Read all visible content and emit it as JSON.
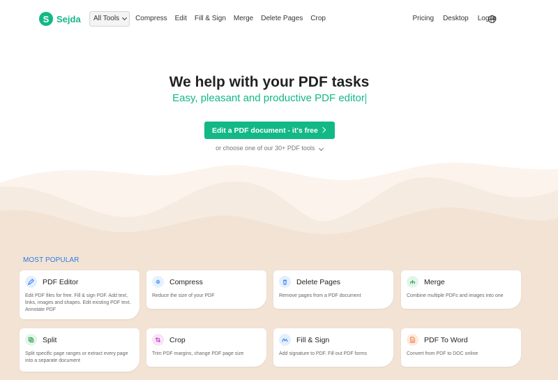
{
  "header": {
    "logo_mark": "S",
    "logo_text": "Sejda",
    "nav_left": [
      "All Tools",
      "Compress",
      "Edit",
      "Fill & Sign",
      "Merge",
      "Delete Pages",
      "Crop"
    ],
    "nav_right": [
      "Pricing",
      "Desktop",
      "Log in"
    ],
    "language_icon": "globe-icon"
  },
  "hero": {
    "title": "We help with your PDF tasks",
    "subtitle": "Easy, pleasant and productive PDF editor",
    "cta_label": "Edit a PDF document - it's free",
    "or_choose": "or choose one of our 30+ PDF tools"
  },
  "popular": {
    "heading": "MOST POPULAR",
    "tools": [
      {
        "title": "PDF Editor",
        "desc": "Edit PDF files for free. Fill & sign PDF. Add text, links, images and shapes. Edit existing PDF text. Annotate PDF",
        "icon": "pencil-icon",
        "color": "#2c7be5",
        "bg": "#e3efff"
      },
      {
        "title": "Compress",
        "desc": "Reduce the size of your PDF",
        "icon": "compress-icon",
        "color": "#2c7be5",
        "bg": "#e6f1ff"
      },
      {
        "title": "Delete Pages",
        "desc": "Remove pages from a PDF document",
        "icon": "trash-icon",
        "color": "#2c7be5",
        "bg": "#e3efff"
      },
      {
        "title": "Merge",
        "desc": "Combine multiple PDFs and images into one",
        "icon": "merge-icon",
        "color": "#2e9e57",
        "bg": "#e3f5e8"
      },
      {
        "title": "Split",
        "desc": "Split specific page ranges or extract every page into a separate document",
        "icon": "split-icon",
        "color": "#2e9e57",
        "bg": "#e3f5e8"
      },
      {
        "title": "Crop",
        "desc": "Trim PDF margins, change PDF page size",
        "icon": "crop-icon",
        "color": "#c640c6",
        "bg": "#f9e3f9"
      },
      {
        "title": "Fill & Sign",
        "desc": "Add signature to PDF. Fill out PDF forms",
        "icon": "signature-icon",
        "color": "#2c7be5",
        "bg": "#e3efff"
      },
      {
        "title": "PDF To Word",
        "desc": "Convert from PDF to DOC online",
        "icon": "word-doc-icon",
        "color": "#e8743b",
        "bg": "#fdeade"
      }
    ]
  }
}
